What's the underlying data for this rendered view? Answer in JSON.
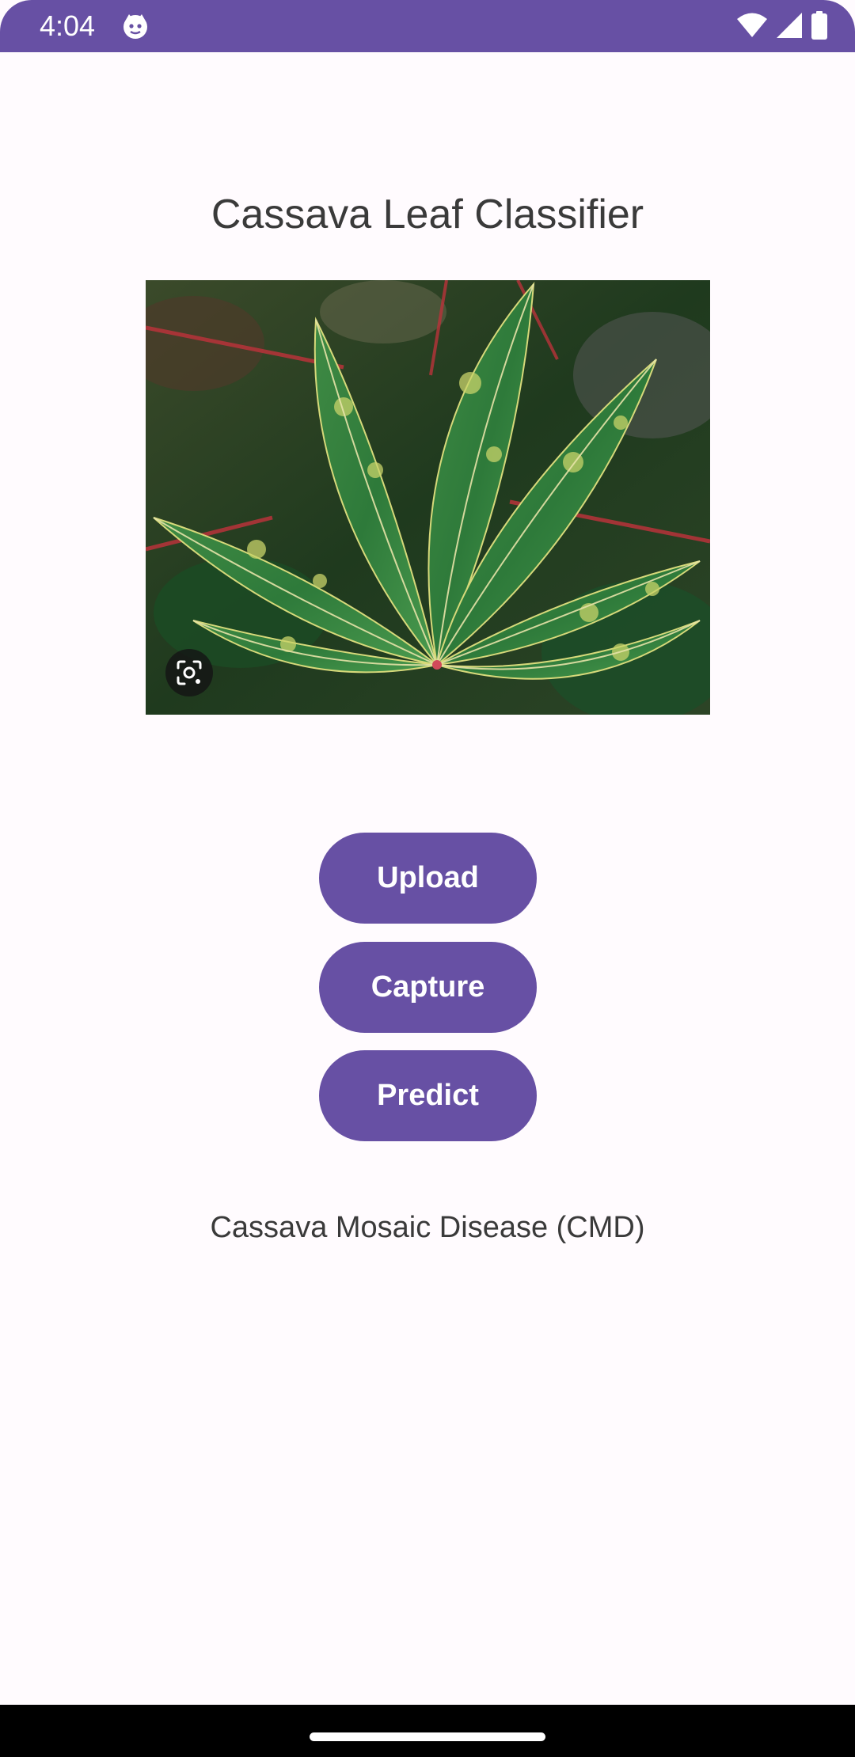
{
  "status_bar": {
    "time": "4:04",
    "background_color": "#6750a4",
    "icons": [
      "app-notification-icon",
      "wifi-icon",
      "cellular-signal-icon",
      "battery-icon"
    ]
  },
  "app": {
    "title": "Cassava Leaf Classifier",
    "accent_color": "#6750a4",
    "background_color": "#fffbfe"
  },
  "image_view": {
    "overlay_icon": "google-lens-icon"
  },
  "buttons": {
    "upload_label": "Upload",
    "capture_label": "Capture",
    "predict_label": "Predict"
  },
  "prediction": {
    "result": "Cassava Mosaic Disease (CMD)"
  },
  "navigation_bar": {
    "icons": [
      "home-handle"
    ]
  }
}
